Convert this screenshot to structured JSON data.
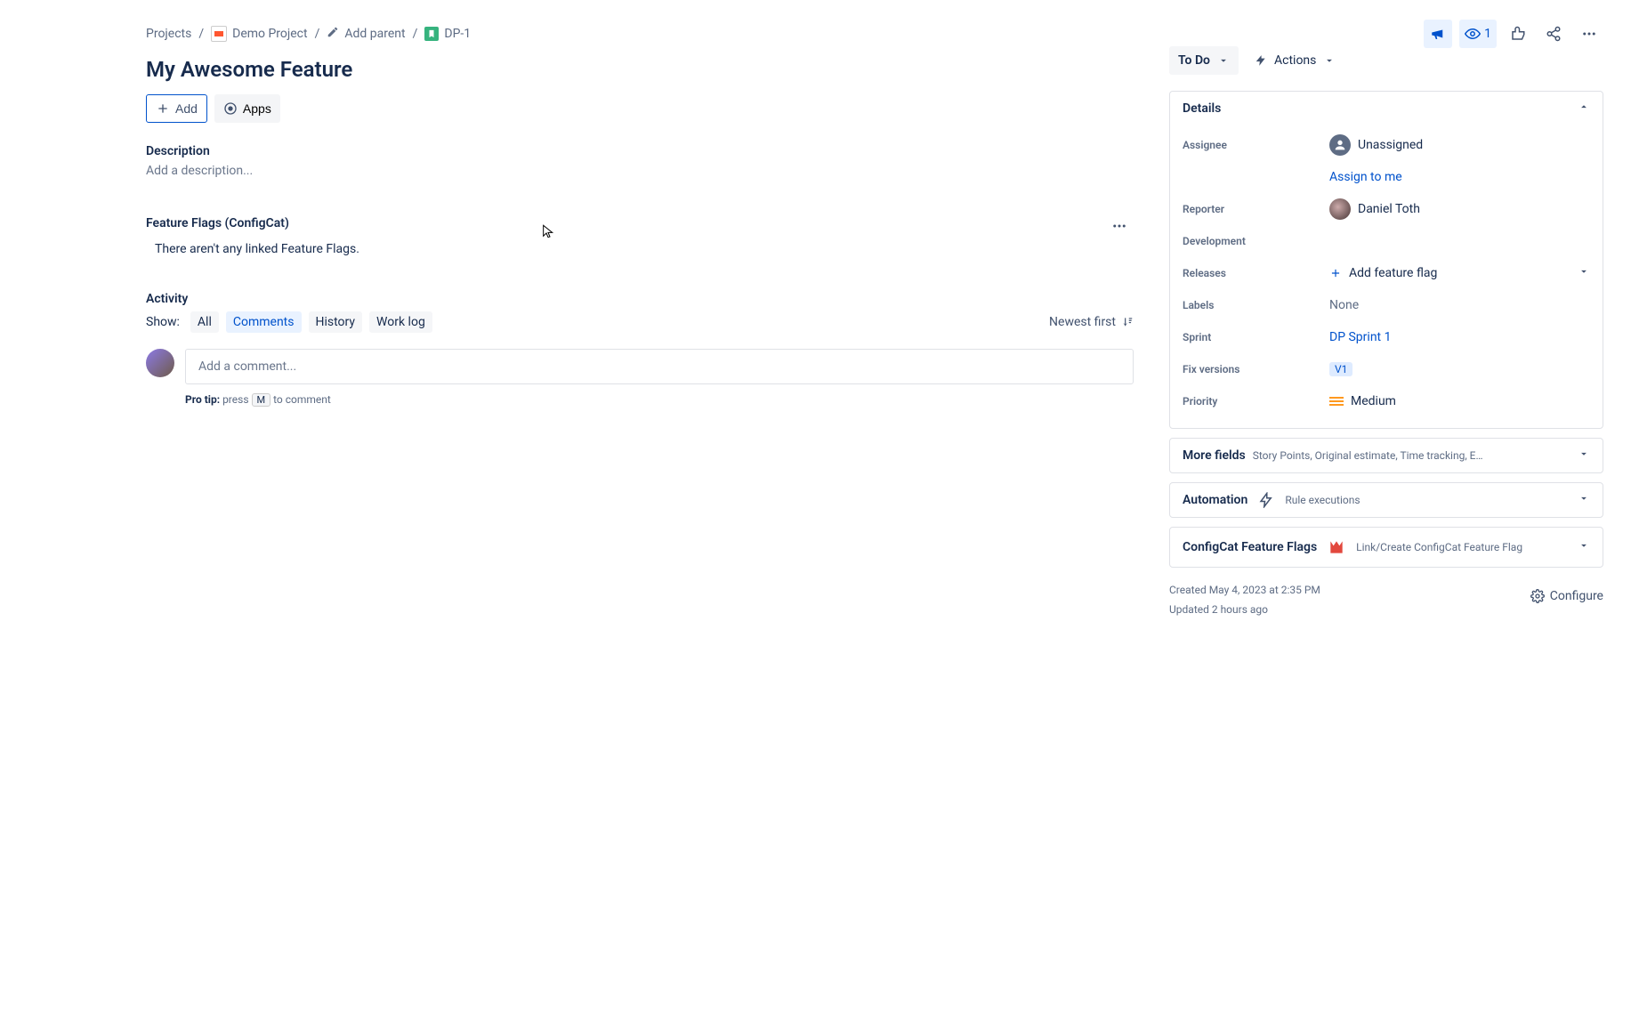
{
  "breadcrumbs": {
    "projects": "Projects",
    "project": "Demo Project",
    "addParent": "Add parent",
    "issueKey": "DP-1"
  },
  "issueTitle": "My Awesome Feature",
  "toolbar": {
    "add": "Add",
    "apps": "Apps"
  },
  "description": {
    "heading": "Description",
    "placeholder": "Add a description..."
  },
  "featureFlagsSection": {
    "heading": "Feature Flags (ConfigCat)",
    "emptyText": "There aren't any linked Feature Flags."
  },
  "activity": {
    "heading": "Activity",
    "showLabel": "Show:",
    "tabs": {
      "all": "All",
      "comments": "Comments",
      "history": "History",
      "worklog": "Work log"
    },
    "sortLabel": "Newest first",
    "commentPlaceholder": "Add a comment...",
    "proTipLabel": "Pro tip:",
    "proTipPress": "press",
    "proTipKey": "M",
    "proTipSuffix": "to comment"
  },
  "topActions": {
    "watchersCount": "1"
  },
  "status": {
    "label": "To Do",
    "actions": "Actions"
  },
  "details": {
    "heading": "Details",
    "assignee": {
      "label": "Assignee",
      "value": "Unassigned",
      "assignToMe": "Assign to me"
    },
    "reporter": {
      "label": "Reporter",
      "value": "Daniel Toth"
    },
    "development": {
      "label": "Development"
    },
    "releases": {
      "label": "Releases",
      "addFlag": "Add feature flag"
    },
    "labels": {
      "label": "Labels",
      "value": "None"
    },
    "sprint": {
      "label": "Sprint",
      "value": "DP Sprint 1"
    },
    "fixVersions": {
      "label": "Fix versions",
      "value": "V1"
    },
    "priority": {
      "label": "Priority",
      "value": "Medium"
    }
  },
  "moreFields": {
    "heading": "More fields",
    "sub": "Story Points, Original estimate, Time tracking, Epic Link, Compone..."
  },
  "automation": {
    "heading": "Automation",
    "sub": "Rule executions"
  },
  "configcat": {
    "heading": "ConfigCat Feature Flags",
    "sub": "Link/Create ConfigCat Feature Flag"
  },
  "meta": {
    "created": "Created May 4, 2023 at 2:35 PM",
    "updated": "Updated 2 hours ago",
    "configure": "Configure"
  }
}
